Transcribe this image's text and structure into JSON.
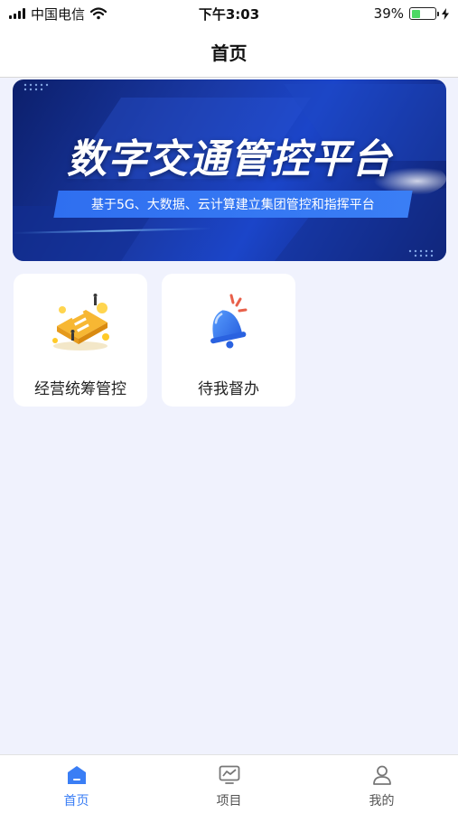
{
  "status_bar": {
    "carrier": "中国电信",
    "time": "下午3:03",
    "battery_percent": "39%",
    "battery_level": 0.39
  },
  "nav": {
    "title": "首页"
  },
  "banner": {
    "title": "数字交通管控平台",
    "subtitle": "基于5G、大数据、云计算建立集团管控和指挥平台"
  },
  "tiles": [
    {
      "label": "经营统筹管控",
      "icon": "operations-illustration-icon"
    },
    {
      "label": "待我督办",
      "icon": "bell-icon"
    }
  ],
  "tab_bar": {
    "items": [
      {
        "label": "首页",
        "icon": "home-icon",
        "active": true
      },
      {
        "label": "项目",
        "icon": "chart-monitor-icon",
        "active": false
      },
      {
        "label": "我的",
        "icon": "user-icon",
        "active": false
      }
    ]
  },
  "colors": {
    "accent": "#3a7ef5",
    "page_bg": "#f0f2fd",
    "banner_dark": "#0c1f6b"
  }
}
